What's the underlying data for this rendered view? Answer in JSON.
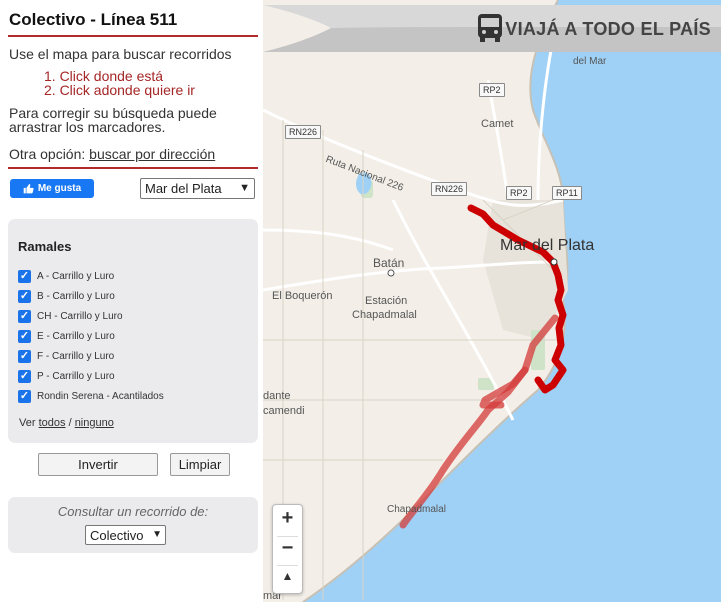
{
  "sidebar": {
    "title": "Colectivo - Línea 511",
    "instructions": "Use el mapa para buscar recorridos",
    "steps": [
      "1. Click donde está",
      "2. Click adonde quiere ir"
    ],
    "hint_line1": "Para corregir su búsqueda puede",
    "hint_line2": "arrastrar los marcadores.",
    "other_option_label": "Otra opción:",
    "other_option_link": "buscar por dirección",
    "like_button": "Me gusta",
    "city": "Mar del Plata",
    "ramales": {
      "title": "Ramales",
      "items": [
        {
          "label": "A - Carrillo y Luro",
          "checked": true
        },
        {
          "label": "B - Carrillo y Luro",
          "checked": true
        },
        {
          "label": "CH - Carrillo y Luro",
          "checked": true
        },
        {
          "label": "E - Carrillo y Luro",
          "checked": true
        },
        {
          "label": "F - Carrillo y Luro",
          "checked": true
        },
        {
          "label": "P - Carrillo y Luro",
          "checked": true
        },
        {
          "label": "Rondin Serena - Acantilados",
          "checked": true
        }
      ],
      "ver_label": "Ver",
      "all_link": "todos",
      "separator": "/",
      "none_link": "ninguno"
    },
    "invert_button": "Invertir",
    "clear_button": "Limpiar",
    "consult_label": "Consultar un recorrido de:",
    "mode": "Colectivo"
  },
  "banner": {
    "text": "VIAJÁ A TODO EL PAÍS",
    "icon": "bus-icon"
  },
  "map": {
    "labels": {
      "camet": "Camet",
      "ruta": "Ruta Nacional 226",
      "city": "Mar del Plata",
      "batan": "Batán",
      "boqueron": "El Boquerón",
      "estacion": "Estación",
      "chapadmalal_area": "Chapadmalal",
      "dante": "dante",
      "camendi": "camendi",
      "chapadmalal": "Chapadmalal",
      "mar": "mar",
      "top_cut": "del Mar"
    },
    "shields": {
      "rp2_top": "RP2",
      "rn226_left": "RN226",
      "rn226_mid": "RN226",
      "rp2_mid": "RP2",
      "rp11": "RP11"
    },
    "zoom_in": "+",
    "zoom_out": "−",
    "compass": "▲"
  },
  "colors": {
    "accent": "#b22a2a",
    "route": "#cc0000",
    "sea": "#9fd1f6"
  }
}
